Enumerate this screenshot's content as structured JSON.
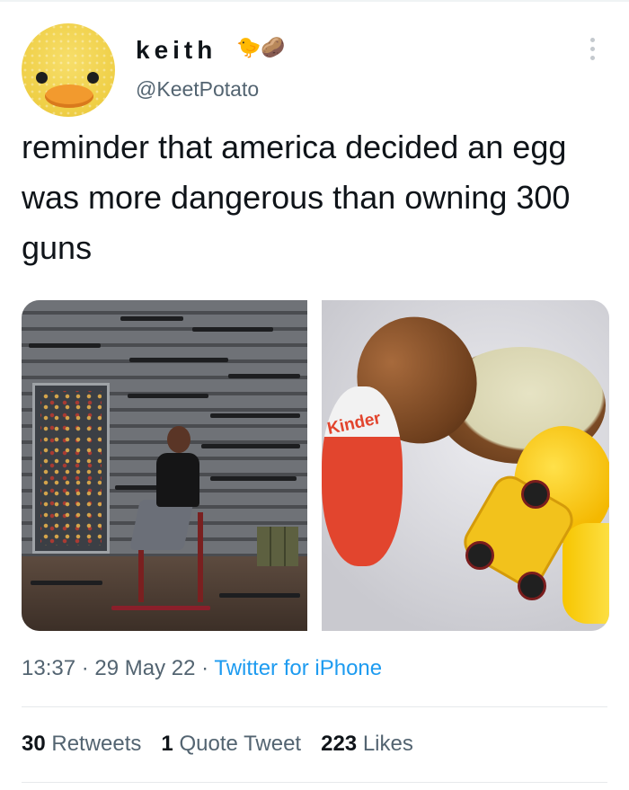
{
  "author": {
    "name": "keith",
    "emoji": "🐤🥔",
    "handle": "@KeetPotato"
  },
  "tweet": {
    "text": "reminder that america decided an egg was more dangerous than owning 300 guns"
  },
  "meta": {
    "time": "13:37",
    "separator": " · ",
    "date": "29 May 22",
    "source": "Twitter for iPhone"
  },
  "stats": {
    "retweets_count": "30",
    "retweets_label": "Retweets",
    "quotes_count": "1",
    "quotes_label": "Quote Tweet",
    "likes_count": "223",
    "likes_label": "Likes"
  },
  "media": {
    "image_2_brand_text": "Kinder"
  },
  "colors": {
    "text_primary": "#0f1419",
    "text_secondary": "#536471",
    "link": "#1d9bf0",
    "divider": "#e6e9eb"
  },
  "icons": {
    "more": "more-dots-icon"
  }
}
